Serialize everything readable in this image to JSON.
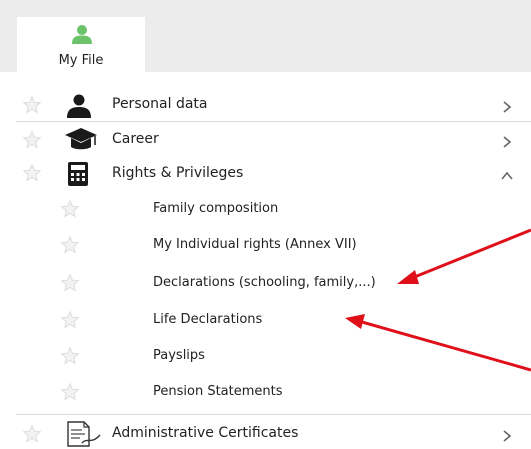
{
  "tab": {
    "label": "My File",
    "icon": "user-icon",
    "icon_color": "#6cc36c"
  },
  "menu": {
    "items": [
      {
        "label": "Personal data",
        "icon": "person-icon",
        "chevron": "chevron-right-icon"
      },
      {
        "label": "Career",
        "icon": "graduation-cap-icon",
        "chevron": "chevron-right-icon"
      },
      {
        "label": "Rights & Privileges",
        "icon": "calculator-icon",
        "chevron": "chevron-up-icon",
        "children": [
          {
            "label": "Family composition"
          },
          {
            "label": "My Individual rights (Annex VII)"
          },
          {
            "label": "Declarations (schooling, family,...)"
          },
          {
            "label": "Life Declarations"
          },
          {
            "label": "Payslips"
          },
          {
            "label": "Pension Statements"
          }
        ]
      },
      {
        "label": "Administrative Certificates",
        "icon": "certificate-document-icon",
        "chevron": "chevron-right-icon"
      }
    ]
  },
  "colors": {
    "annotation_arrow": "#e0101a",
    "star": "#d8d8d8",
    "divider": "#dcdcdc"
  }
}
